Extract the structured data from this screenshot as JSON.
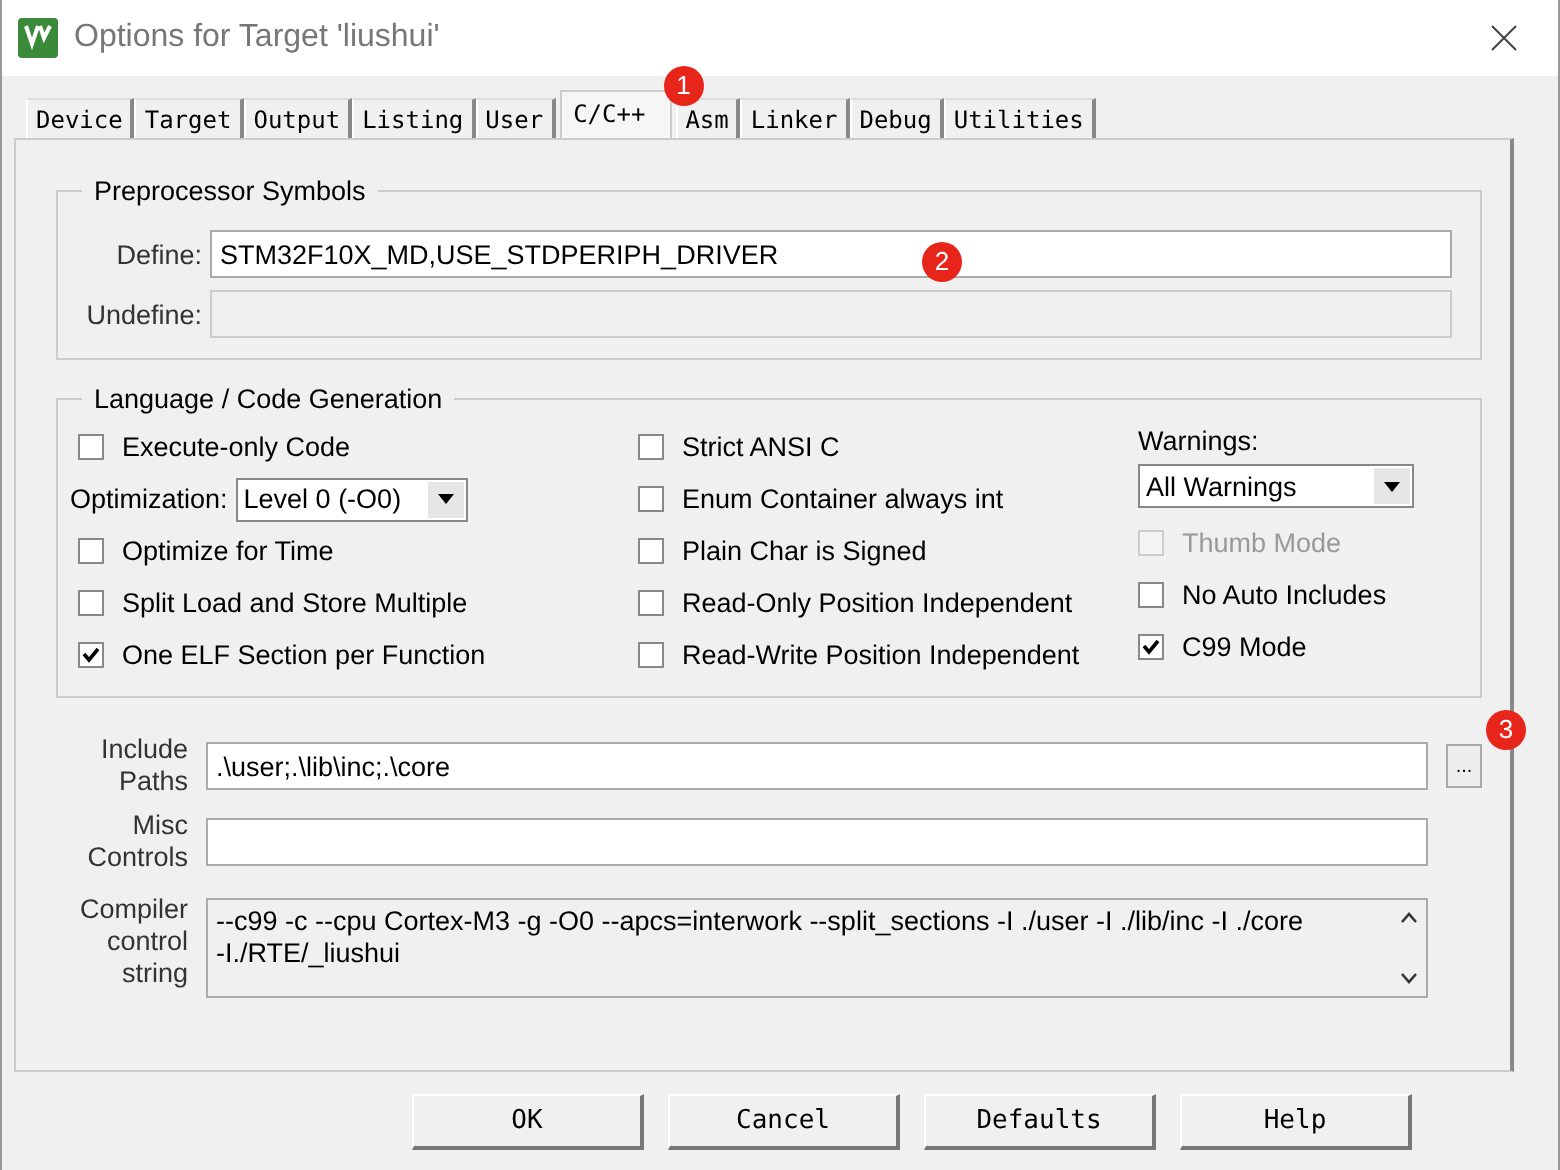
{
  "window": {
    "title": "Options for Target 'liushui'"
  },
  "tabs": [
    {
      "label": "Device",
      "selected": false
    },
    {
      "label": "Target",
      "selected": false
    },
    {
      "label": "Output",
      "selected": false
    },
    {
      "label": "Listing",
      "selected": false
    },
    {
      "label": "User",
      "selected": false
    },
    {
      "label": "C/C++",
      "selected": true,
      "badge": "1"
    },
    {
      "label": "Asm",
      "selected": false
    },
    {
      "label": "Linker",
      "selected": false
    },
    {
      "label": "Debug",
      "selected": false
    },
    {
      "label": "Utilities",
      "selected": false
    }
  ],
  "preprocessor": {
    "title": "Preprocessor Symbols",
    "fields": [
      {
        "label": "Define:",
        "value": "STM32F10X_MD,USE_STDPERIPH_DRIVER",
        "disabled": false,
        "badge": "2"
      },
      {
        "label": "Undefine:",
        "disabled": true
      }
    ]
  },
  "codegen": {
    "title": "Language / Code Generation",
    "columns": [
      [
        {
          "kind": "checkbox",
          "label": "Execute-only Code",
          "checked": false,
          "disabled": false
        },
        {
          "kind": "select",
          "label": "Optimization:",
          "value": "Level 0 (-O0)"
        },
        {
          "kind": "checkbox",
          "label": "Optimize for Time",
          "checked": false,
          "disabled": false
        },
        {
          "kind": "checkbox",
          "label": "Split Load and Store Multiple",
          "checked": false,
          "disabled": false
        },
        {
          "kind": "checkbox",
          "label": "One ELF Section per Function",
          "checked": true,
          "disabled": false
        }
      ],
      [
        {
          "kind": "checkbox",
          "label": "Strict ANSI C",
          "checked": false,
          "disabled": false
        },
        {
          "kind": "checkbox",
          "label": "Enum Container always int",
          "checked": false,
          "disabled": false
        },
        {
          "kind": "checkbox",
          "label": "Plain Char is Signed",
          "checked": false,
          "disabled": false
        },
        {
          "kind": "checkbox",
          "label": "Read-Only Position Independent",
          "checked": false,
          "disabled": false
        },
        {
          "kind": "checkbox",
          "label": "Read-Write Position Independent",
          "checked": false,
          "disabled": false
        }
      ],
      [
        {
          "kind": "stacked-select",
          "label": "Warnings:",
          "value": "All Warnings"
        },
        {
          "kind": "checkbox",
          "label": "Thumb Mode",
          "checked": false,
          "disabled": true
        },
        {
          "kind": "checkbox",
          "label": "No Auto Includes",
          "checked": false,
          "disabled": false
        },
        {
          "kind": "checkbox",
          "label": "C99 Mode",
          "checked": true,
          "disabled": false
        }
      ]
    ]
  },
  "paths": [
    {
      "kind": "line",
      "label": "Include Paths",
      "value": ".\\user;.\\lib\\inc;.\\core",
      "browse": "...",
      "badge": "3"
    },
    {
      "kind": "line",
      "label": "Misc Controls"
    },
    {
      "kind": "multiline",
      "label": "Compiler control string",
      "lines": [
        "--c99 -c --cpu Cortex-M3 -g -O0 --apcs=interwork --split_sections -I ./user -I ./lib/inc -I ./core",
        "-I./RTE/_liushui"
      ]
    }
  ],
  "buttons": [
    "OK",
    "Cancel",
    "Defaults",
    "Help"
  ]
}
